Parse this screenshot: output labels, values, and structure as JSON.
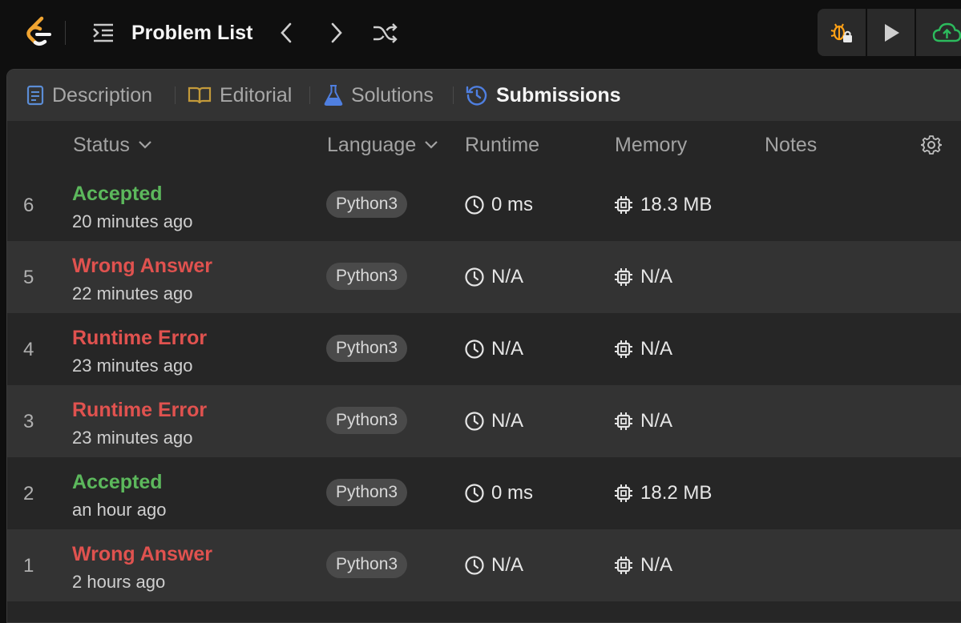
{
  "topbar": {
    "title": "Problem List",
    "icons": [
      "leetcode-logo",
      "list-icon",
      "chevron-left-icon",
      "chevron-right-icon",
      "shuffle-icon",
      "debug-lock-icon",
      "play-icon",
      "upload-cloud-icon"
    ],
    "colors": {
      "logo_orange": "#f0a431",
      "debug_orange": "#ffa116",
      "cloud_green": "#2cbb5d"
    }
  },
  "tabs": [
    {
      "label": "Description",
      "icon": "description-icon",
      "color": "#5b8dd6"
    },
    {
      "label": "Editorial",
      "icon": "book-icon",
      "color": "#c39a3a"
    },
    {
      "label": "Solutions",
      "icon": "flask-icon",
      "color": "#4f7fe0"
    },
    {
      "label": "Submissions",
      "icon": "history-icon",
      "color": "#4f7fe0",
      "active": true
    }
  ],
  "table": {
    "headers": {
      "status": "Status",
      "language": "Language",
      "runtime": "Runtime",
      "memory": "Memory",
      "notes": "Notes"
    },
    "rows": [
      {
        "num": "6",
        "status": "Accepted",
        "ok": true,
        "time": "20 minutes ago",
        "lang": "Python3",
        "runtime": "0 ms",
        "memory": "18.3 MB"
      },
      {
        "num": "5",
        "status": "Wrong Answer",
        "ok": false,
        "time": "22 minutes ago",
        "lang": "Python3",
        "runtime": "N/A",
        "memory": "N/A"
      },
      {
        "num": "4",
        "status": "Runtime Error",
        "ok": false,
        "time": "23 minutes ago",
        "lang": "Python3",
        "runtime": "N/A",
        "memory": "N/A"
      },
      {
        "num": "3",
        "status": "Runtime Error",
        "ok": false,
        "time": "23 minutes ago",
        "lang": "Python3",
        "runtime": "N/A",
        "memory": "N/A"
      },
      {
        "num": "2",
        "status": "Accepted",
        "ok": true,
        "time": "an hour ago",
        "lang": "Python3",
        "runtime": "0 ms",
        "memory": "18.2 MB"
      },
      {
        "num": "1",
        "status": "Wrong Answer",
        "ok": false,
        "time": "2 hours ago",
        "lang": "Python3",
        "runtime": "N/A",
        "memory": "N/A"
      }
    ]
  },
  "colors": {
    "accepted": "#5cb85c",
    "error": "#e0524f"
  }
}
